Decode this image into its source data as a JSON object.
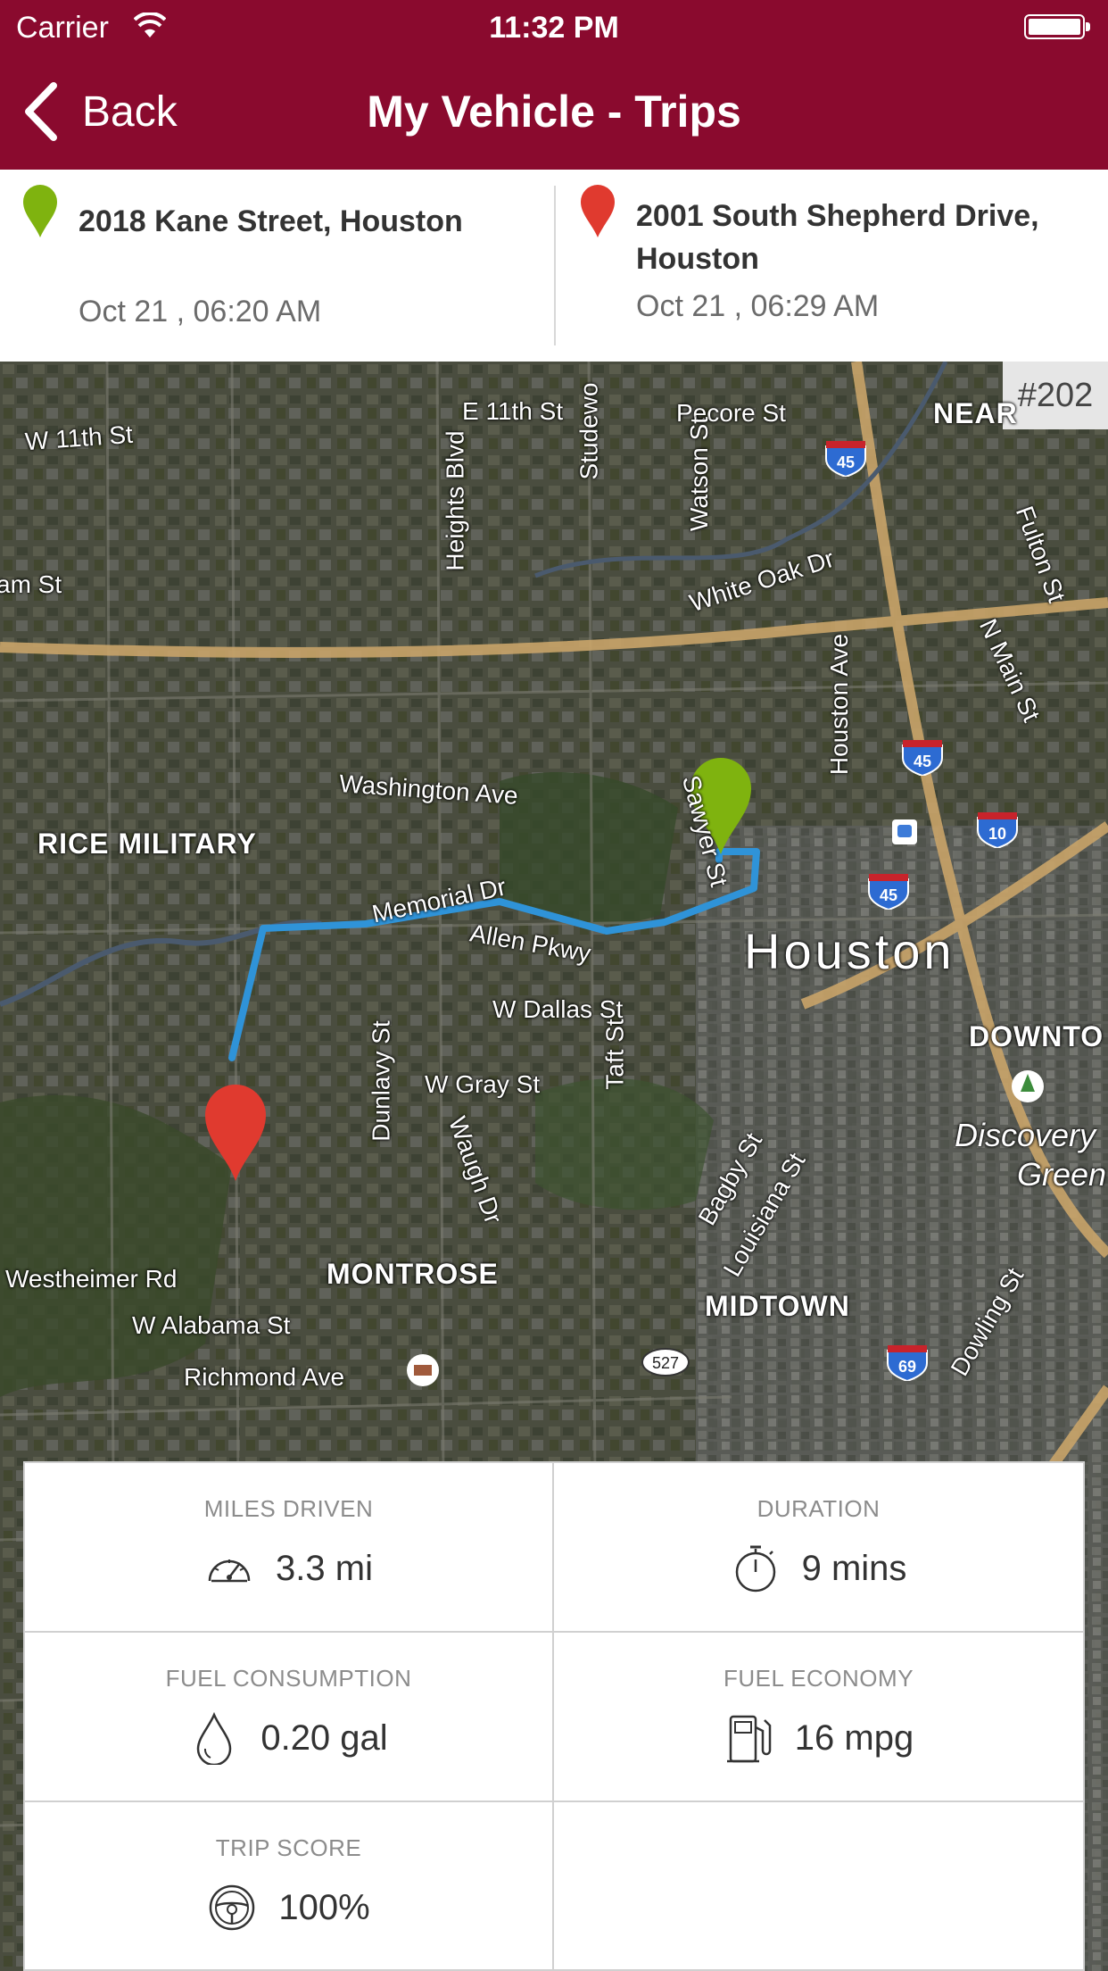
{
  "status_bar": {
    "carrier": "Carrier",
    "time": "11:32 PM"
  },
  "nav": {
    "back_label": "Back",
    "title": "My Vehicle - Trips"
  },
  "trip": {
    "start": {
      "address": "2018 Kane Street, Houston",
      "time": "Oct 21 , 06:20 AM",
      "pin_color": "#7fb30f"
    },
    "end": {
      "address": "2001 South Shepherd Drive, Houston",
      "time": "Oct 21 , 06:29 AM",
      "pin_color": "#e03a2f"
    }
  },
  "map": {
    "badge": "#202",
    "route_color": "#2f93d8",
    "labels": {
      "w11th": "W 11th St",
      "e11th": "E 11th St",
      "pecore": "Pecore St",
      "near": "NEAR",
      "heights": "Heights Blvd",
      "studewood": "Studewo",
      "watson": "Watson St",
      "whiteoak": "White Oak Dr",
      "fulton": "Fulton St",
      "nmain": "N Main St",
      "am": "am St",
      "washington": "Washington Ave",
      "sawyer": "Sawyer St",
      "houstonave": "Houston Ave",
      "rice": "RICE MILITARY",
      "memorial": "Memorial Dr",
      "allen": "Allen Pkwy",
      "houston": "Houston",
      "wdallas": "W Dallas St",
      "downtown": "DOWNTO",
      "dunlavy": "Dunlavy St",
      "wgray": "W Gray St",
      "taft": "Taft St",
      "waugh": "Waugh Dr",
      "bagby": "Bagby St",
      "louisiana": "Louisiana St",
      "discovery": "Discovery",
      "green": "Green",
      "westheimer": "Westheimer Rd",
      "montrose": "MONTROSE",
      "midtown": "MIDTOWN",
      "walabama": "W Alabama St",
      "dowling": "Dowling St",
      "richmond": "Richmond Ave"
    },
    "shields": {
      "i45a": "45",
      "i45b": "45",
      "i45c": "45",
      "i10": "10",
      "i69": "69",
      "r527": "527"
    }
  },
  "stats": {
    "miles": {
      "label": "MILES DRIVEN",
      "value": "3.3 mi",
      "icon": "speedometer-icon"
    },
    "duration": {
      "label": "DURATION",
      "value": "9 mins",
      "icon": "stopwatch-icon"
    },
    "fuel_consumption": {
      "label": "FUEL CONSUMPTION",
      "value": "0.20 gal",
      "icon": "fuel-drop-icon"
    },
    "fuel_economy": {
      "label": "FUEL ECONOMY",
      "value": "16 mpg",
      "icon": "fuel-pump-icon"
    },
    "trip_score": {
      "label": "TRIP SCORE",
      "value": "100%",
      "icon": "steering-wheel-icon"
    }
  }
}
